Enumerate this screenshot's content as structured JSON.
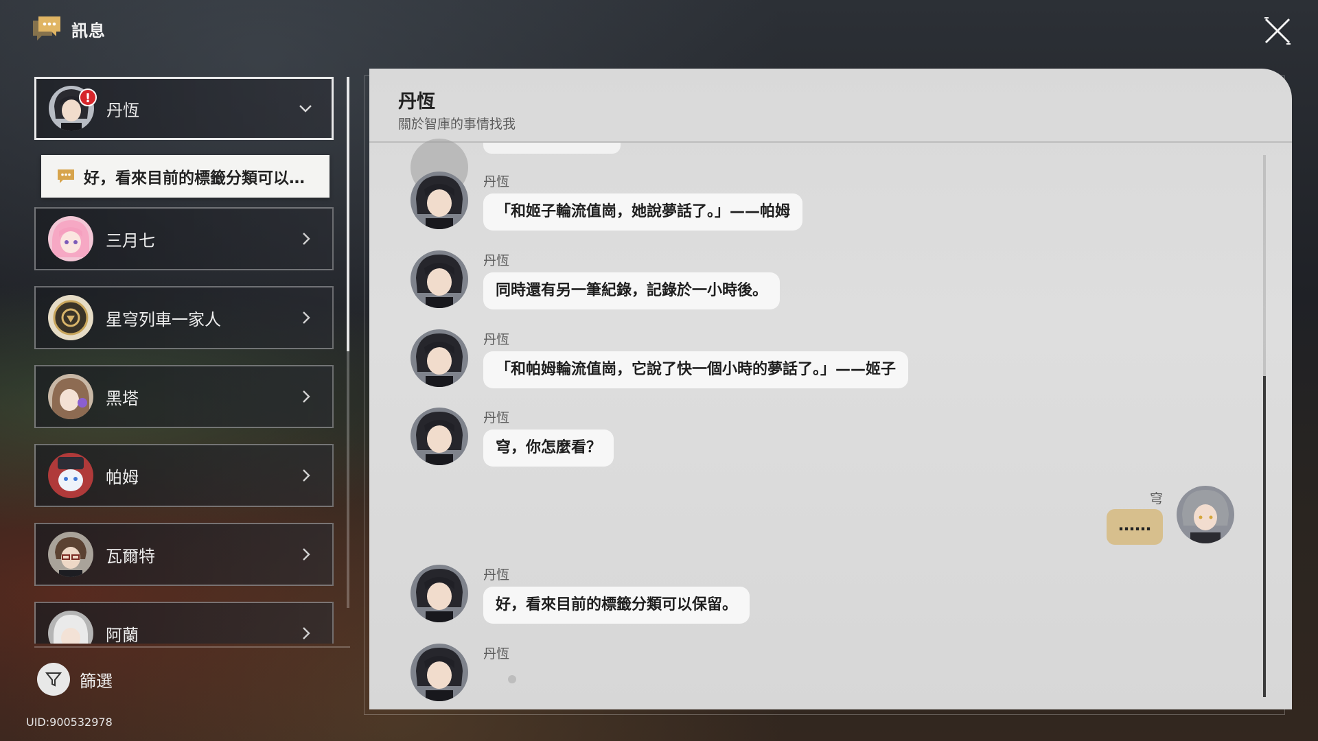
{
  "header": {
    "title": "訊息"
  },
  "contacts": [
    {
      "name": "丹恆",
      "active": true,
      "alert": "!"
    },
    {
      "name": "三月七"
    },
    {
      "name": "星穹列車一家人"
    },
    {
      "name": "黑塔"
    },
    {
      "name": "帕姆"
    },
    {
      "name": "瓦爾特"
    },
    {
      "name": "阿蘭"
    }
  ],
  "preview": {
    "text": "好，看來目前的標籤分類可以…"
  },
  "filter": {
    "label": "篩選"
  },
  "uid": "UID:900532978",
  "chat": {
    "title": "丹恆",
    "subtitle": "關於智庫的事情找我",
    "messages": [
      {
        "sender": "丹恆",
        "text": "「和姬子輪流值崗，她說夢話了。」——帕姆"
      },
      {
        "sender": "丹恆",
        "text": "同時還有另一筆紀錄，記錄於一小時後。"
      },
      {
        "sender": "丹恆",
        "text": "「和帕姆輪流值崗，它說了快一個小時的夢話了。」——姬子"
      },
      {
        "sender": "丹恆",
        "text": "穹，你怎麼看？"
      }
    ],
    "self_message": {
      "sender": "穹",
      "text": "……"
    },
    "messages_after": [
      {
        "sender": "丹恆",
        "text": "好，看來目前的標籤分類可以保留。"
      },
      {
        "sender": "丹恆"
      }
    ]
  },
  "colors": {
    "self_bubble": "#d7bf8d",
    "other_bubble": "#f7f7f7",
    "alert": "#d6262b",
    "panel": "#d9d9d9"
  },
  "icons": {
    "header": "chat-bubble-icon",
    "close": "close-icon",
    "chevron_active": "chevron-down-icon",
    "chevron": "chevron-right-icon",
    "filter": "funnel-icon"
  }
}
